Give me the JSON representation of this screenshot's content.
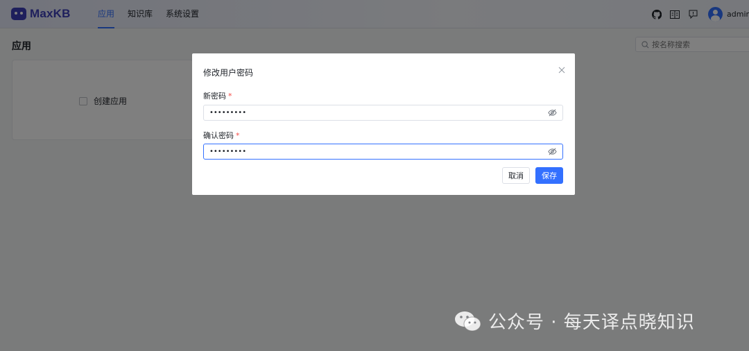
{
  "header": {
    "logo_text": "MaxKB",
    "nav": [
      {
        "label": "应用",
        "active": true
      },
      {
        "label": "知识库",
        "active": false
      },
      {
        "label": "系统设置",
        "active": false
      }
    ],
    "icons": [
      "github-icon",
      "book-icon",
      "feedback-icon"
    ],
    "user_name": "admin"
  },
  "page": {
    "title": "应用",
    "search_placeholder": "按名称搜索",
    "create_label": "创建应用"
  },
  "dialog": {
    "title": "修改用户密码",
    "new_password_label": "新密码",
    "new_password_value": "•••••••••",
    "confirm_password_label": "确认密码",
    "confirm_password_value": "•••••••••",
    "required_mark": "*",
    "cancel_label": "取消",
    "save_label": "保存"
  },
  "watermark": {
    "text": "公众号 · 每天译点晓知识"
  },
  "colors": {
    "primary": "#3370ff",
    "brand": "#3d3fb8",
    "required": "#f54a45"
  }
}
